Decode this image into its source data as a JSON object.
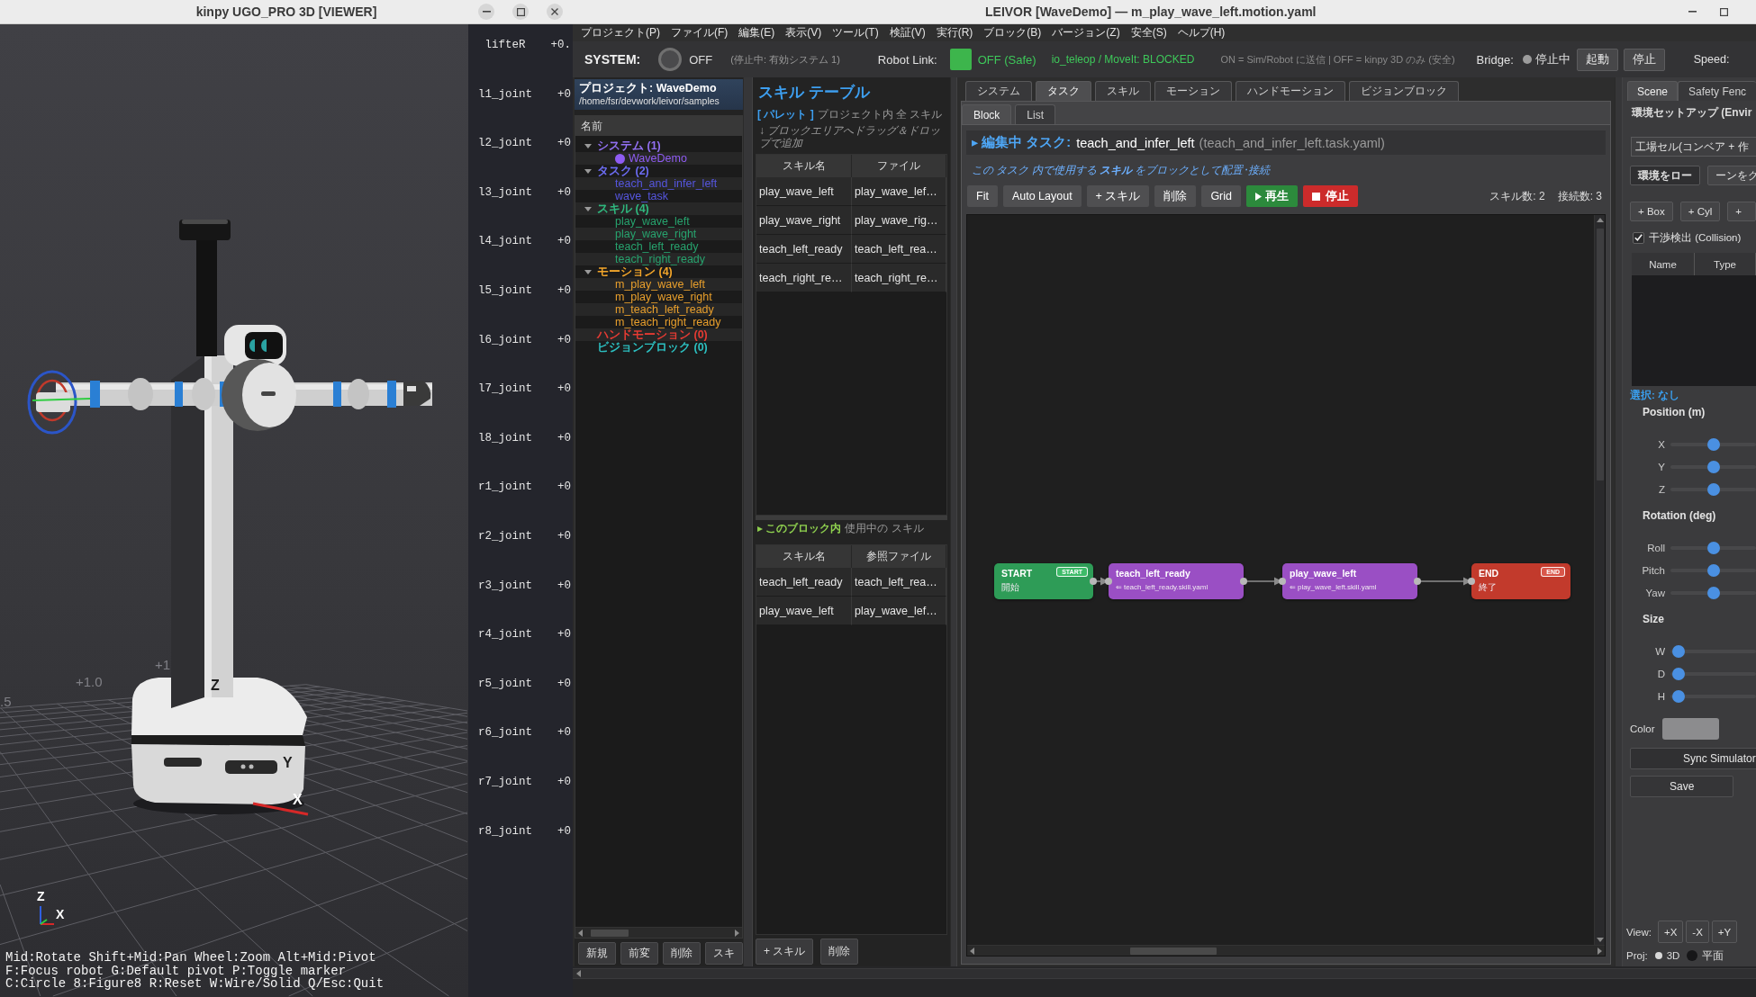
{
  "viewer_window": {
    "title": "kinpy UGO_PRO 3D [VIEWER]",
    "grid_labels": [
      "+1.0",
      "+1",
      ".5"
    ],
    "robot_axis_labels": [
      "Z",
      "Y",
      "X"
    ],
    "gizmo_labels": [
      "Z",
      "X"
    ],
    "joints": [
      {
        "name": "lifteR",
        "value": "+0."
      },
      {
        "name": "l1_joint",
        "value": "+0"
      },
      {
        "name": "l2_joint",
        "value": "+0"
      },
      {
        "name": "l3_joint",
        "value": "+0"
      },
      {
        "name": "l4_joint",
        "value": "+0"
      },
      {
        "name": "l5_joint",
        "value": "+0"
      },
      {
        "name": "l6_joint",
        "value": "+0"
      },
      {
        "name": "l7_joint",
        "value": "+0"
      },
      {
        "name": "l8_joint",
        "value": "+0"
      },
      {
        "name": "r1_joint",
        "value": "+0"
      },
      {
        "name": "r2_joint",
        "value": "+0"
      },
      {
        "name": "r3_joint",
        "value": "+0"
      },
      {
        "name": "r4_joint",
        "value": "+0"
      },
      {
        "name": "r5_joint",
        "value": "+0"
      },
      {
        "name": "r6_joint",
        "value": "+0"
      },
      {
        "name": "r7_joint",
        "value": "+0"
      },
      {
        "name": "r8_joint",
        "value": "+0"
      }
    ],
    "help_lines": [
      "Mid:Rotate Shift+Mid:Pan Wheel:Zoom Alt+Mid:Pivot",
      "F:Focus robot G:Default pivot P:Toggle marker",
      "C:Circle 8:Figure8 R:Reset W:Wire/Solid Q/Esc:Quit"
    ]
  },
  "editor_window": {
    "title": "LEIVOR [WaveDemo] — m_play_wave_left.motion.yaml",
    "menu": [
      "プロジェクト(P)",
      "ファイル(F)",
      "編集(E)",
      "表示(V)",
      "ツール(T)",
      "検証(V)",
      "実行(R)",
      "ブロック(B)",
      "バージョン(Z)",
      "安全(S)",
      "ヘルプ(H)"
    ],
    "toolbar": {
      "system": {
        "label": "SYSTEM:",
        "on": false,
        "state": "OFF",
        "note": "(停止中: 有効システム 1)"
      },
      "robot_link": {
        "label": "Robot Link:",
        "safe": true,
        "state": "OFF (Safe)",
        "status": "io_teleop / MoveIt: BLOCKED"
      },
      "mode_note": "ON = Sim/Robot に送信 | OFF = kinpy 3D のみ (安全)",
      "bridge": {
        "label": "Bridge:",
        "running": false,
        "state": "停止中",
        "buttons": [
          "起動",
          "停止"
        ]
      },
      "speed": {
        "label": "Speed:"
      }
    },
    "project_panel": {
      "title": "プロジェクト: WaveDemo",
      "path": "/home/fsr/devwork/leivor/samples",
      "tree": {
        "column": "名前",
        "items": [
          {
            "label": "システム (1)",
            "color": "#9270f2",
            "expanded": true,
            "children": [
              {
                "label": "WaveDemo",
                "color": "#8f5cf2",
                "kind": "system"
              }
            ]
          },
          {
            "label": "タスク (2)",
            "color": "#6c6cf2",
            "expanded": true,
            "children": [
              {
                "label": "teach_and_infer_left",
                "color": "#5656e0",
                "kind": "file"
              },
              {
                "label": "wave_task",
                "color": "#5656e0",
                "kind": "file"
              }
            ]
          },
          {
            "label": "スキル (4)",
            "color": "#2fb87e",
            "expanded": true,
            "children": [
              {
                "label": "play_wave_left",
                "color": "#27a36e",
                "kind": "file"
              },
              {
                "label": "play_wave_right",
                "color": "#27a36e",
                "kind": "file"
              },
              {
                "label": "teach_left_ready",
                "color": "#27a36e",
                "kind": "file"
              },
              {
                "label": "teach_right_ready",
                "color": "#27a36e",
                "kind": "file"
              }
            ]
          },
          {
            "label": "モーション (4)",
            "color": "#f2a52a",
            "expanded": true,
            "children": [
              {
                "label": "m_play_wave_left",
                "color": "#e89f2c",
                "kind": "file"
              },
              {
                "label": "m_play_wave_right",
                "color": "#e89f2c",
                "kind": "file"
              },
              {
                "label": "m_teach_left_ready",
                "color": "#e89f2c",
                "kind": "file"
              },
              {
                "label": "m_teach_right_ready",
                "color": "#e89f2c",
                "kind": "file"
              }
            ]
          },
          {
            "label": "ハンドモーション (0)",
            "color": "#e53b33"
          },
          {
            "label": "ビジョンブロック (0)",
            "color": "#2cbfc0"
          }
        ]
      },
      "buttons": [
        "新規",
        "前変",
        "削除",
        "スキ"
      ]
    },
    "skill_table": {
      "title": "スキル テーブル",
      "palette": {
        "tag": "[ パレット ]",
        "note": "プロジェクト内 全 スキル",
        "hint": "↓ ブロックエリアへドラッグ＆ドロップで追加",
        "columns": [
          "スキル名",
          "ファイル"
        ],
        "rows": [
          [
            "play_wave_left",
            "play_wave_lef…"
          ],
          [
            "play_wave_right",
            "play_wave_rig…"
          ],
          [
            "teach_left_ready",
            "teach_left_rea…"
          ],
          [
            "teach_right_re…",
            "teach_right_re…"
          ]
        ]
      },
      "in_block": {
        "tag": "▸ このブロック内",
        "note": "使用中の スキル",
        "columns": [
          "スキル名",
          "参照ファイル"
        ],
        "rows": [
          [
            "teach_left_ready",
            "teach_left_rea…"
          ],
          [
            "play_wave_left",
            "play_wave_lef…"
          ]
        ]
      },
      "buttons": [
        "+ スキル",
        "削除"
      ]
    },
    "task_editor": {
      "tabs": [
        {
          "label": "システム",
          "selected": false
        },
        {
          "label": "タスク",
          "selected": true
        },
        {
          "label": "スキル",
          "selected": false
        },
        {
          "label": "モーション",
          "selected": false
        },
        {
          "label": "ハンドモーション",
          "selected": false
        },
        {
          "label": "ビジョンブロック",
          "selected": false
        }
      ],
      "view_tabs": [
        {
          "label": "Block",
          "selected": true
        },
        {
          "label": "List",
          "selected": false
        }
      ],
      "heading": {
        "prefix": "▸ 編集中 タスク:",
        "name": "teach_and_infer_left",
        "file": "(teach_and_infer_left.task.yaml)"
      },
      "description": "この タスク 内で使用する **スキル** をブロックとして配置･接続",
      "tools": [
        {
          "label": "Fit",
          "kind": "plain"
        },
        {
          "label": "Auto Layout",
          "kind": "plain"
        },
        {
          "label": "+ スキル",
          "kind": "plain"
        },
        {
          "label": "削除",
          "kind": "plain"
        },
        {
          "label": "Grid",
          "kind": "plain"
        },
        {
          "label": "再生",
          "kind": "play"
        },
        {
          "label": "停止",
          "kind": "stop"
        }
      ],
      "stats": [
        "スキル数: 2",
        "接続数: 3"
      ],
      "nodes": [
        {
          "title": "START",
          "kind": "start",
          "badge": "START",
          "subtitle": "開始"
        },
        {
          "title": "teach_left_ready",
          "kind": "skill",
          "subtitle": "⇐ teach_left_ready.skill.yaml"
        },
        {
          "title": "play_wave_left",
          "kind": "skill",
          "subtitle": "⇐ play_wave_left.skill.yaml"
        },
        {
          "title": "END",
          "kind": "end",
          "badge": "END",
          "subtitle": "終了"
        }
      ]
    },
    "scene_panel": {
      "tabs": [
        {
          "label": "Scene",
          "selected": true
        },
        {
          "label": "Safety Fenc",
          "selected": false
        }
      ],
      "title": "環境セットアップ (Envir",
      "preset": "工場セル(コンベア + 作",
      "env_buttons": [
        "環境をロー",
        "ーンをク"
      ],
      "add_buttons": [
        "+ Box",
        "+ Cyl",
        "+"
      ],
      "collision": {
        "label": "干渉検出 (Collision)",
        "checked": true
      },
      "object_columns": [
        "Name",
        "Type"
      ],
      "selection": "選択: なし",
      "groups": [
        {
          "title": "Position (m)",
          "sliders": [
            {
              "label": "X",
              "level": 0.5
            },
            {
              "label": "Y",
              "level": 0.5
            },
            {
              "label": "Z",
              "level": 0.5
            }
          ]
        },
        {
          "title": "Rotation (deg)",
          "sliders": [
            {
              "label": "Roll",
              "level": 0.5
            },
            {
              "label": "Pitch",
              "level": 0.5
            },
            {
              "label": "Yaw",
              "level": 0.5
            }
          ]
        },
        {
          "title": "Size",
          "sliders": [
            {
              "label": "W",
              "level": 0.02
            },
            {
              "label": "D",
              "level": 0.02
            },
            {
              "label": "H",
              "level": 0.02
            }
          ]
        }
      ],
      "color_label": "Color",
      "sync_button": "Sync Simulator",
      "save_button": "Save",
      "view": {
        "label": "View:",
        "buttons": [
          "+X",
          "-X",
          "+Y"
        ]
      },
      "projection": {
        "label": "Proj:",
        "options": [
          {
            "label": "3D",
            "selected": true
          },
          {
            "label": "平面",
            "selected": false
          }
        ]
      }
    }
  }
}
